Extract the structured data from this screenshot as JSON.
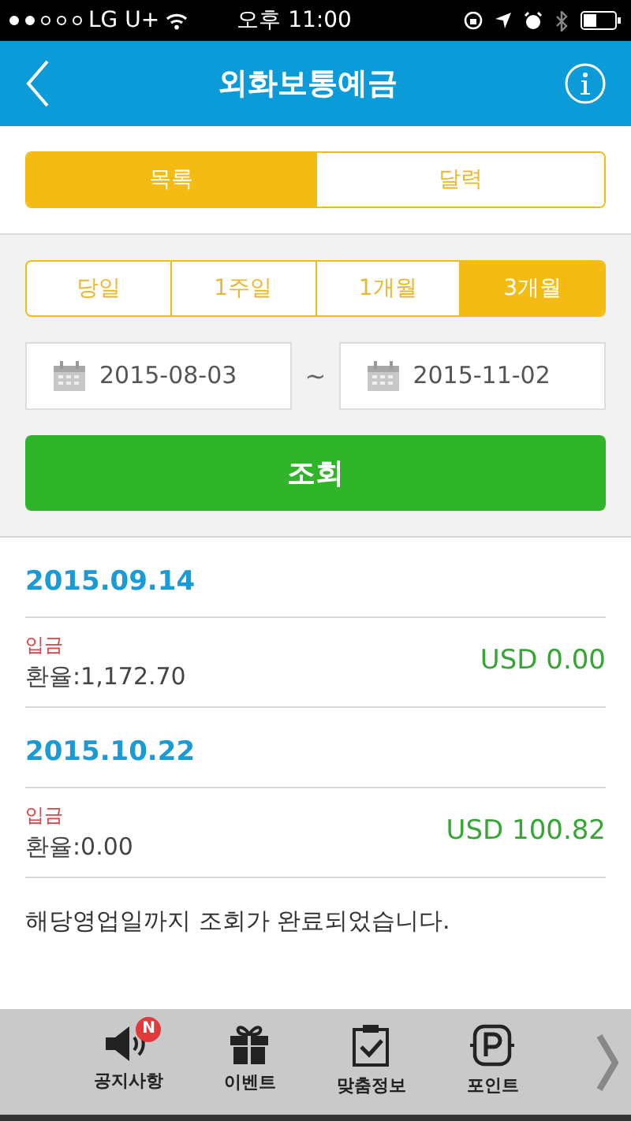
{
  "status_bar": {
    "signal_dots": [
      {
        "on": true
      },
      {
        "on": true
      },
      {
        "on": false
      },
      {
        "on": false
      },
      {
        "on": false
      }
    ],
    "carrier": "LG U+",
    "time": "오후 11:00"
  },
  "header": {
    "title": "외화보통예금"
  },
  "view_tabs": [
    {
      "label": "목록",
      "selected": true
    },
    {
      "label": "달력",
      "selected": false
    }
  ],
  "period_tabs": [
    {
      "label": "당일",
      "selected": false
    },
    {
      "label": "1주일",
      "selected": false
    },
    {
      "label": "1개월",
      "selected": false
    },
    {
      "label": "3개월",
      "selected": true
    }
  ],
  "date_range": {
    "start": "2015-08-03",
    "separator": "~",
    "end": "2015-11-02"
  },
  "search_button": "조회",
  "transactions": [
    {
      "date": "2015.09.14",
      "type": "입금",
      "rate": "환율:1,172.70",
      "amount": "USD 0.00"
    },
    {
      "date": "2015.10.22",
      "type": "입금",
      "rate": "환율:0.00",
      "amount": "USD 100.82"
    }
  ],
  "footer_message": "해당영업일까지 조회가 완료되었습니다.",
  "bottom_nav": [
    {
      "label": "공지사항",
      "badge": "N"
    },
    {
      "label": "이벤트"
    },
    {
      "label": "맞춤정보"
    },
    {
      "label": "포인트"
    }
  ]
}
